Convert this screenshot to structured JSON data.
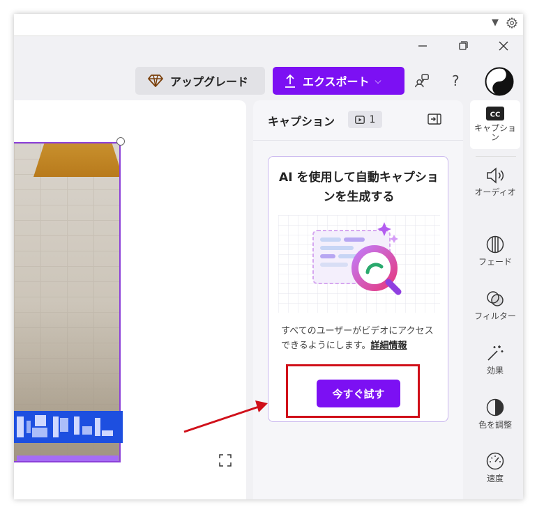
{
  "browser": {
    "dropdown_icon": "triangle-down-icon",
    "settings_icon": "gear-icon"
  },
  "window_controls": {
    "minimize": "minimize-icon",
    "restore": "restore-icon",
    "close": "close-icon"
  },
  "topbar": {
    "upgrade_label": "アップグレード",
    "export_label": "エクスポート",
    "help_label": "?"
  },
  "panel": {
    "title": "キャプション",
    "count": "1",
    "promo": {
      "title": "AI を使用して自動キャプションを生成する",
      "body": "すべてのユーザーがビデオにアクセスできるようにします。",
      "more_link": "詳細情報",
      "button": "今すぐ試す"
    }
  },
  "rail": {
    "items": [
      {
        "label": "キャプション",
        "icon": "cc-icon"
      },
      {
        "label": "オーディオ",
        "icon": "speaker-icon"
      },
      {
        "label": "フェード",
        "icon": "fade-icon"
      },
      {
        "label": "フィルター",
        "icon": "filter-icon"
      },
      {
        "label": "効果",
        "icon": "magic-wand-icon"
      },
      {
        "label": "色を調整",
        "icon": "contrast-icon"
      },
      {
        "label": "速度",
        "icon": "speedometer-icon"
      }
    ]
  },
  "colors": {
    "accent": "#7c10f3",
    "annotation": "#d0101a",
    "caption_bg": "#1d4fe0"
  }
}
